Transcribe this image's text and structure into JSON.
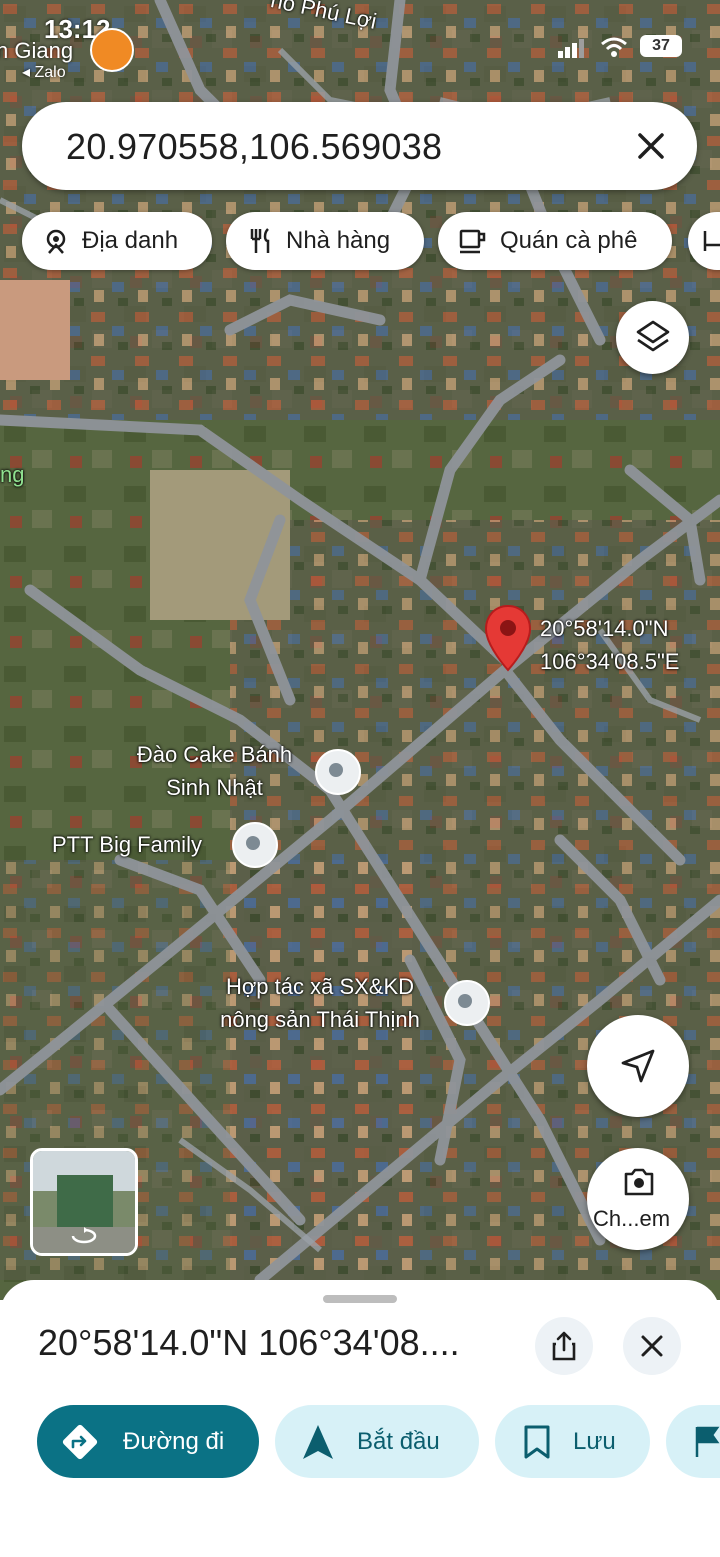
{
  "status_bar": {
    "time": "13:12",
    "carrier": "n Giang",
    "back_app": "◂ Zalo",
    "battery": "37",
    "icons": [
      "signal-icon",
      "wifi-icon",
      "battery-icon"
    ]
  },
  "search": {
    "query": "20.970558,106.569038",
    "clear_icon": "close-icon"
  },
  "chips": [
    {
      "label": "Địa danh",
      "icon": "landmark-icon"
    },
    {
      "label": "Nhà hàng",
      "icon": "restaurant-icon"
    },
    {
      "label": "Quán cà phê",
      "icon": "cafe-icon"
    }
  ],
  "map": {
    "street_label": "hố Phú Lợi",
    "edge_label": "ng",
    "pin_label_line1": "20°58'14.0\"N",
    "pin_label_line2": "106°34'08.5\"E",
    "pois": [
      {
        "line1": "Đào Cake Bánh",
        "line2": "Sinh Nhật"
      },
      {
        "line1": "PTT Big Family",
        "line2": ""
      },
      {
        "line1": "Hợp tác xã SX&KD",
        "line2": "nông sản Thái Thịnh"
      }
    ],
    "camera_label": "Ch...em"
  },
  "sheet": {
    "title": "20°58'14.0\"N 106°34'08....",
    "actions": [
      {
        "label": "Đường đi",
        "icon": "directions-icon"
      },
      {
        "label": "Bắt đầu",
        "icon": "navigation-arrow-icon"
      },
      {
        "label": "Lưu",
        "icon": "bookmark-icon"
      }
    ]
  },
  "colors": {
    "accent": "#0b7285",
    "secondary_bg": "#d7f1f7",
    "pin": "#e53935"
  }
}
